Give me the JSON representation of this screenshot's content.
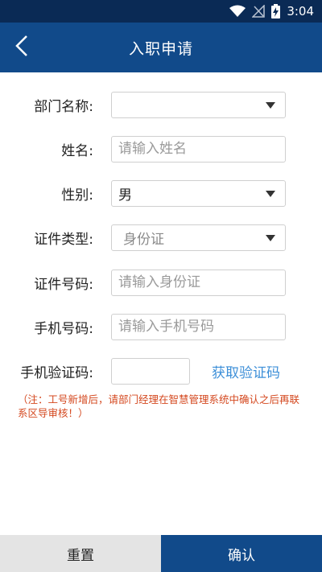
{
  "status_bar": {
    "time": "3:04",
    "icons": [
      "wifi-icon",
      "no-signal-icon",
      "battery-charging-icon"
    ]
  },
  "header": {
    "title": "入职申请",
    "back_icon": "chevron-left-icon"
  },
  "form": {
    "department": {
      "label": "部门名称:",
      "value": ""
    },
    "name": {
      "label": "姓名:",
      "placeholder": "请输入姓名"
    },
    "gender": {
      "label": "性别:",
      "value": "男"
    },
    "id_type": {
      "label": "证件类型:",
      "value": "身份证"
    },
    "id_number": {
      "label": "证件号码:",
      "placeholder": "请输入身份证"
    },
    "phone": {
      "label": "手机号码:",
      "placeholder": "请输入手机号码"
    },
    "code": {
      "label": "手机验证码:",
      "button": "获取验证码"
    }
  },
  "note": "（注：工号新增后，请部门经理在智慧管理系统中确认之后再联系区导审核！）",
  "actions": {
    "reset": "重置",
    "confirm": "确认"
  },
  "colors": {
    "primary": "#114a8a",
    "status_bar": "#0a2a55",
    "link": "#3d8fd8",
    "note": "#d4481f"
  }
}
